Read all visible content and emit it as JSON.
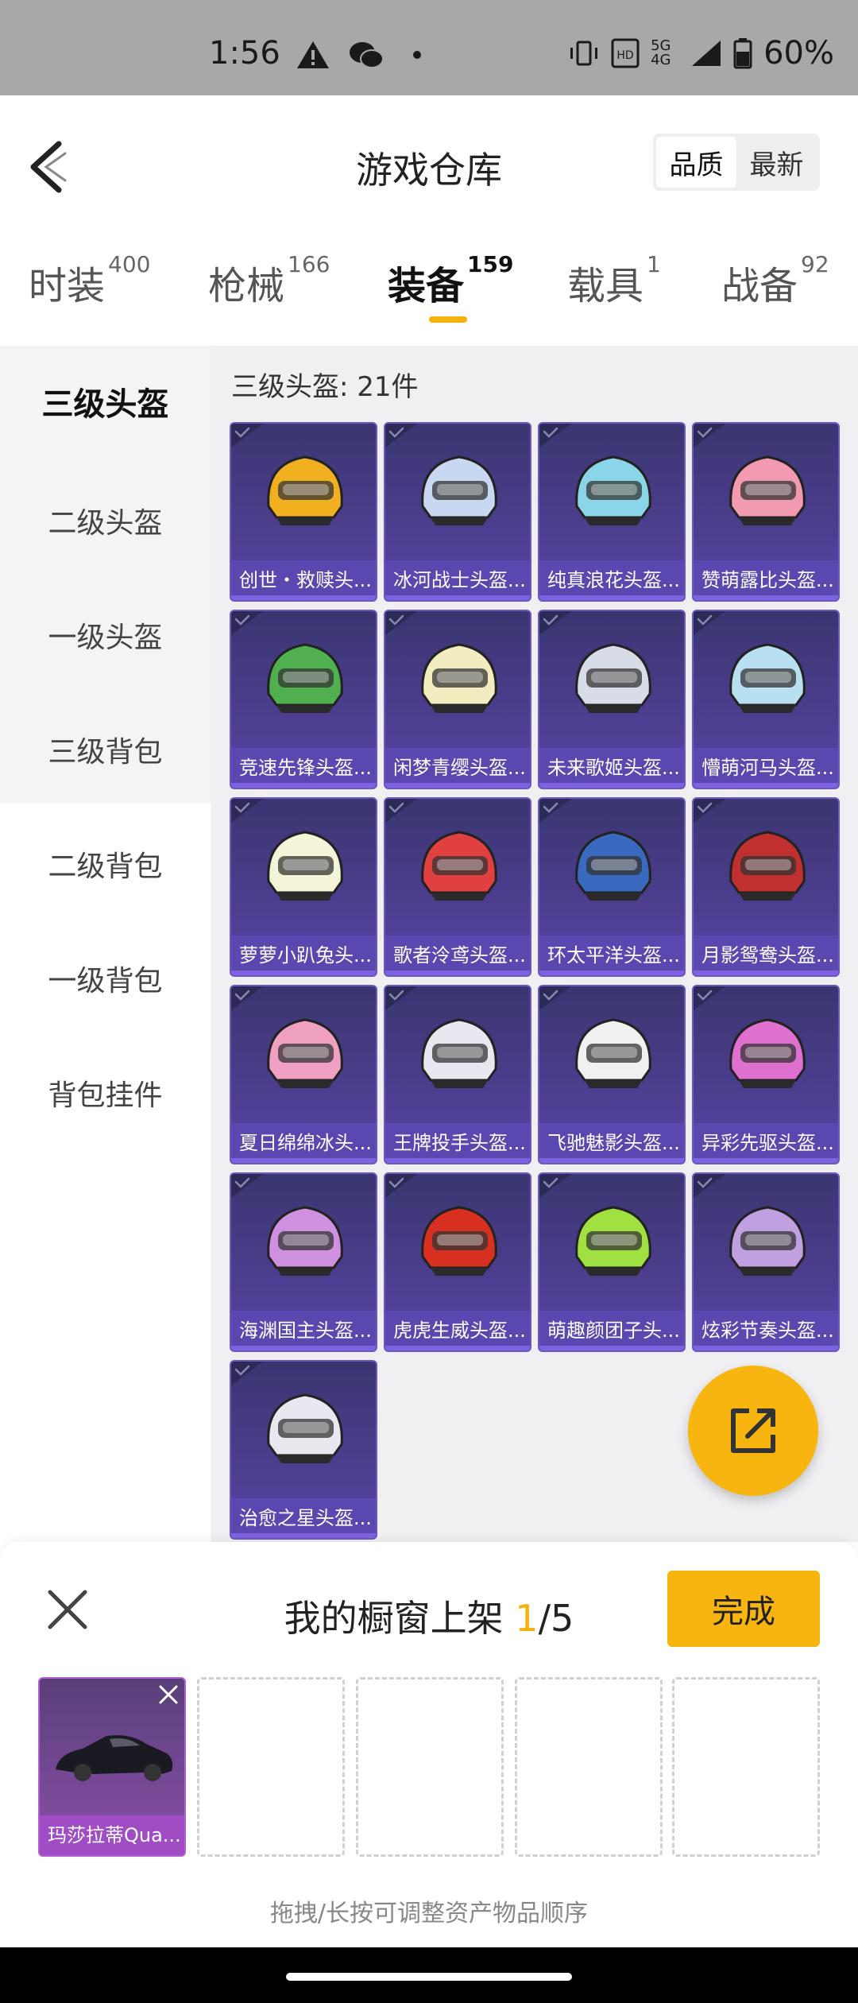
{
  "status_bar": {
    "time": "1:56",
    "network": "5G 4G",
    "battery": "60%"
  },
  "header": {
    "title": "游戏仓库",
    "sort_options": [
      "品质",
      "最新"
    ],
    "active_sort": "品质"
  },
  "tabs": [
    {
      "label": "时装",
      "count": "400"
    },
    {
      "label": "枪械",
      "count": "166"
    },
    {
      "label": "装备",
      "count": "159"
    },
    {
      "label": "载具",
      "count": "1"
    },
    {
      "label": "战备",
      "count": "92"
    }
  ],
  "active_tab": "装备",
  "sidebar": {
    "items": [
      "三级头盔",
      "二级头盔",
      "一级头盔",
      "三级背包",
      "二级背包",
      "一级背包",
      "背包挂件"
    ],
    "active": "三级头盔"
  },
  "section": {
    "title": "三级头盔: 21件"
  },
  "items": [
    {
      "name": "创世・救赎头...",
      "color": "#f0b020"
    },
    {
      "name": "冰河战士头盔...",
      "color": "#c8d8f0"
    },
    {
      "name": "纯真浪花头盔...",
      "color": "#8ad6e8"
    },
    {
      "name": "赞萌露比头盔...",
      "color": "#f29ab0"
    },
    {
      "name": "竞速先锋头盔...",
      "color": "#50b050"
    },
    {
      "name": "闲梦青缨头盔...",
      "color": "#f2ecc0"
    },
    {
      "name": "未来歌姬头盔...",
      "color": "#d8dce8"
    },
    {
      "name": "懵萌河马头盔...",
      "color": "#b8e0f0"
    },
    {
      "name": "萝萝小趴兔头...",
      "color": "#f4f4d8"
    },
    {
      "name": "歌者泠鸢头盔...",
      "color": "#e04040"
    },
    {
      "name": "环太平洋头盔...",
      "color": "#3a6ac0"
    },
    {
      "name": "月影鸳鸯头盔...",
      "color": "#c03030"
    },
    {
      "name": "夏日绵绵冰头...",
      "color": "#f0a0c0"
    },
    {
      "name": "王牌投手头盔...",
      "color": "#e8e8f0"
    },
    {
      "name": "飞驰魅影头盔...",
      "color": "#f0f0f0"
    },
    {
      "name": "异彩先驱头盔...",
      "color": "#e070d0"
    },
    {
      "name": "海渊国主头盔...",
      "color": "#d090e0"
    },
    {
      "name": "虎虎生威头盔...",
      "color": "#d83020"
    },
    {
      "name": "萌趣颜团子头...",
      "color": "#a0e040"
    },
    {
      "name": "炫彩节奏头盔...",
      "color": "#c0a0e0"
    },
    {
      "name": "治愈之星头盔...",
      "color": "#e8e8f0"
    }
  ],
  "panel": {
    "title_prefix": "我的橱窗上架",
    "current": "1",
    "total": "/5",
    "done_label": "完成",
    "filled_item": "玛莎拉蒂Qua...",
    "hint": "拖拽/长按可调整资产物品顺序"
  },
  "colors": {
    "accent": "#f8b40f",
    "card": "#4b3d8c"
  }
}
